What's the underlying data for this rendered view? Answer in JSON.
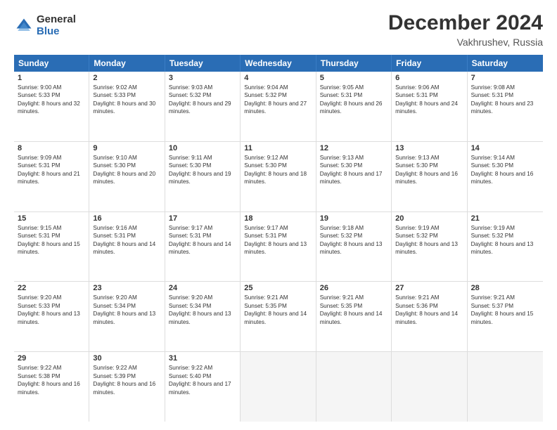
{
  "logo": {
    "general": "General",
    "blue": "Blue"
  },
  "title": "December 2024",
  "location": "Vakhrushev, Russia",
  "header": {
    "days": [
      "Sunday",
      "Monday",
      "Tuesday",
      "Wednesday",
      "Thursday",
      "Friday",
      "Saturday"
    ]
  },
  "weeks": [
    [
      {
        "day": "1",
        "sunrise": "9:00 AM",
        "sunset": "5:33 PM",
        "daylight": "8 hours and 32 minutes."
      },
      {
        "day": "2",
        "sunrise": "9:02 AM",
        "sunset": "5:33 PM",
        "daylight": "8 hours and 30 minutes."
      },
      {
        "day": "3",
        "sunrise": "9:03 AM",
        "sunset": "5:32 PM",
        "daylight": "8 hours and 29 minutes."
      },
      {
        "day": "4",
        "sunrise": "9:04 AM",
        "sunset": "5:32 PM",
        "daylight": "8 hours and 27 minutes."
      },
      {
        "day": "5",
        "sunrise": "9:05 AM",
        "sunset": "5:31 PM",
        "daylight": "8 hours and 26 minutes."
      },
      {
        "day": "6",
        "sunrise": "9:06 AM",
        "sunset": "5:31 PM",
        "daylight": "8 hours and 24 minutes."
      },
      {
        "day": "7",
        "sunrise": "9:08 AM",
        "sunset": "5:31 PM",
        "daylight": "8 hours and 23 minutes."
      }
    ],
    [
      {
        "day": "8",
        "sunrise": "9:09 AM",
        "sunset": "5:31 PM",
        "daylight": "8 hours and 21 minutes."
      },
      {
        "day": "9",
        "sunrise": "9:10 AM",
        "sunset": "5:30 PM",
        "daylight": "8 hours and 20 minutes."
      },
      {
        "day": "10",
        "sunrise": "9:11 AM",
        "sunset": "5:30 PM",
        "daylight": "8 hours and 19 minutes."
      },
      {
        "day": "11",
        "sunrise": "9:12 AM",
        "sunset": "5:30 PM",
        "daylight": "8 hours and 18 minutes."
      },
      {
        "day": "12",
        "sunrise": "9:13 AM",
        "sunset": "5:30 PM",
        "daylight": "8 hours and 17 minutes."
      },
      {
        "day": "13",
        "sunrise": "9:13 AM",
        "sunset": "5:30 PM",
        "daylight": "8 hours and 16 minutes."
      },
      {
        "day": "14",
        "sunrise": "9:14 AM",
        "sunset": "5:30 PM",
        "daylight": "8 hours and 16 minutes."
      }
    ],
    [
      {
        "day": "15",
        "sunrise": "9:15 AM",
        "sunset": "5:31 PM",
        "daylight": "8 hours and 15 minutes."
      },
      {
        "day": "16",
        "sunrise": "9:16 AM",
        "sunset": "5:31 PM",
        "daylight": "8 hours and 14 minutes."
      },
      {
        "day": "17",
        "sunrise": "9:17 AM",
        "sunset": "5:31 PM",
        "daylight": "8 hours and 14 minutes."
      },
      {
        "day": "18",
        "sunrise": "9:17 AM",
        "sunset": "5:31 PM",
        "daylight": "8 hours and 13 minutes."
      },
      {
        "day": "19",
        "sunrise": "9:18 AM",
        "sunset": "5:32 PM",
        "daylight": "8 hours and 13 minutes."
      },
      {
        "day": "20",
        "sunrise": "9:19 AM",
        "sunset": "5:32 PM",
        "daylight": "8 hours and 13 minutes."
      },
      {
        "day": "21",
        "sunrise": "9:19 AM",
        "sunset": "5:32 PM",
        "daylight": "8 hours and 13 minutes."
      }
    ],
    [
      {
        "day": "22",
        "sunrise": "9:20 AM",
        "sunset": "5:33 PM",
        "daylight": "8 hours and 13 minutes."
      },
      {
        "day": "23",
        "sunrise": "9:20 AM",
        "sunset": "5:34 PM",
        "daylight": "8 hours and 13 minutes."
      },
      {
        "day": "24",
        "sunrise": "9:20 AM",
        "sunset": "5:34 PM",
        "daylight": "8 hours and 13 minutes."
      },
      {
        "day": "25",
        "sunrise": "9:21 AM",
        "sunset": "5:35 PM",
        "daylight": "8 hours and 14 minutes."
      },
      {
        "day": "26",
        "sunrise": "9:21 AM",
        "sunset": "5:35 PM",
        "daylight": "8 hours and 14 minutes."
      },
      {
        "day": "27",
        "sunrise": "9:21 AM",
        "sunset": "5:36 PM",
        "daylight": "8 hours and 14 minutes."
      },
      {
        "day": "28",
        "sunrise": "9:21 AM",
        "sunset": "5:37 PM",
        "daylight": "8 hours and 15 minutes."
      }
    ],
    [
      {
        "day": "29",
        "sunrise": "9:22 AM",
        "sunset": "5:38 PM",
        "daylight": "8 hours and 16 minutes."
      },
      {
        "day": "30",
        "sunrise": "9:22 AM",
        "sunset": "5:39 PM",
        "daylight": "8 hours and 16 minutes."
      },
      {
        "day": "31",
        "sunrise": "9:22 AM",
        "sunset": "5:40 PM",
        "daylight": "8 hours and 17 minutes."
      },
      null,
      null,
      null,
      null
    ]
  ]
}
